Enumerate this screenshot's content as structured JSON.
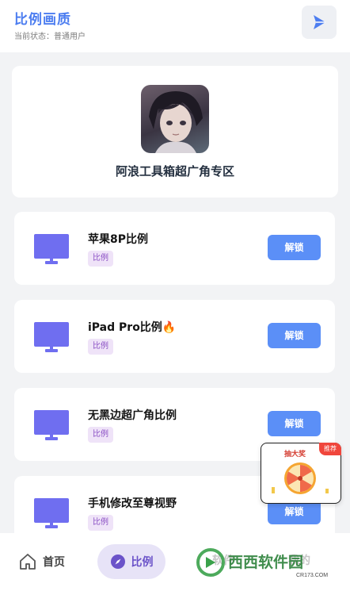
{
  "header": {
    "title": "比例画质",
    "status": "当前状态：普通用户",
    "share_icon": "play-share-icon"
  },
  "banner": {
    "name": "阿浪工具箱超广角专区"
  },
  "cards": [
    {
      "name": "苹果8P比例",
      "tag": "比例",
      "button": "解锁"
    },
    {
      "name": "iPad Pro比例🔥",
      "tag": "比例",
      "button": "解锁"
    },
    {
      "name": "无黑边超广角比例",
      "tag": "比例",
      "button": "解锁"
    },
    {
      "name": "手机修改至尊视野",
      "tag": "比例",
      "button": "解锁"
    }
  ],
  "popup": {
    "badge": "推荐",
    "title": "抽大奖"
  },
  "tabbar": {
    "home": "首页",
    "ratio": "比例",
    "hidden_tab_1": "软件",
    "hidden_tab_2": "我的"
  },
  "watermark": {
    "text": "西西软件园",
    "sub": "CR173.COM"
  },
  "colors": {
    "accent": "#4c7df0",
    "unlock_button": "#5b8ff7",
    "monitor": "#6f6ef0",
    "tag_bg": "#efe3f8",
    "tab_active_bg": "#e7e3f7"
  }
}
